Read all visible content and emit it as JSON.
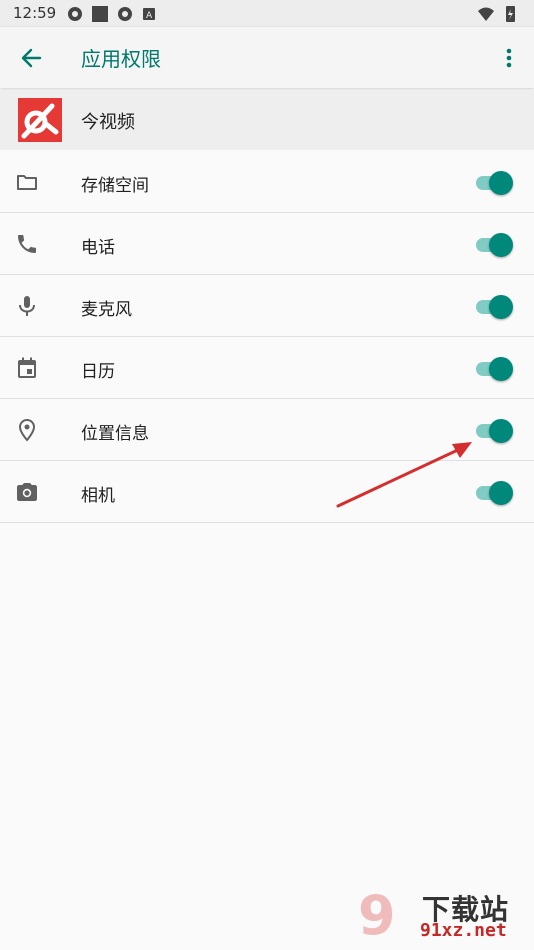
{
  "status_bar": {
    "time": "12:59",
    "left_icons": [
      "settings-gear-icon",
      "square-icon",
      "settings-gear-icon",
      "a-badge-icon"
    ],
    "right_icons": [
      "wifi-icon",
      "battery-charging-icon"
    ]
  },
  "app_bar": {
    "title": "应用权限",
    "back_icon": "arrow-back-icon",
    "menu_icon": "more-vert-icon",
    "accent": "#00796b"
  },
  "app_header": {
    "name": "今视频",
    "logo_color": "#e53935"
  },
  "permissions": [
    {
      "label": "存储空间",
      "icon": "folder-icon",
      "enabled": true
    },
    {
      "label": "电话",
      "icon": "phone-icon",
      "enabled": true
    },
    {
      "label": "麦克风",
      "icon": "microphone-icon",
      "enabled": true
    },
    {
      "label": "日历",
      "icon": "calendar-icon",
      "enabled": true
    },
    {
      "label": "位置信息",
      "icon": "location-pin-icon",
      "enabled": true
    },
    {
      "label": "相机",
      "icon": "camera-icon",
      "enabled": true
    }
  ],
  "colors": {
    "switch_on_thumb": "#00897b",
    "switch_on_track": "#80cbc4",
    "annotation_arrow": "#d32f2f"
  },
  "watermark": {
    "number": "9",
    "brand": "下载站",
    "domain": "91xz.net"
  }
}
